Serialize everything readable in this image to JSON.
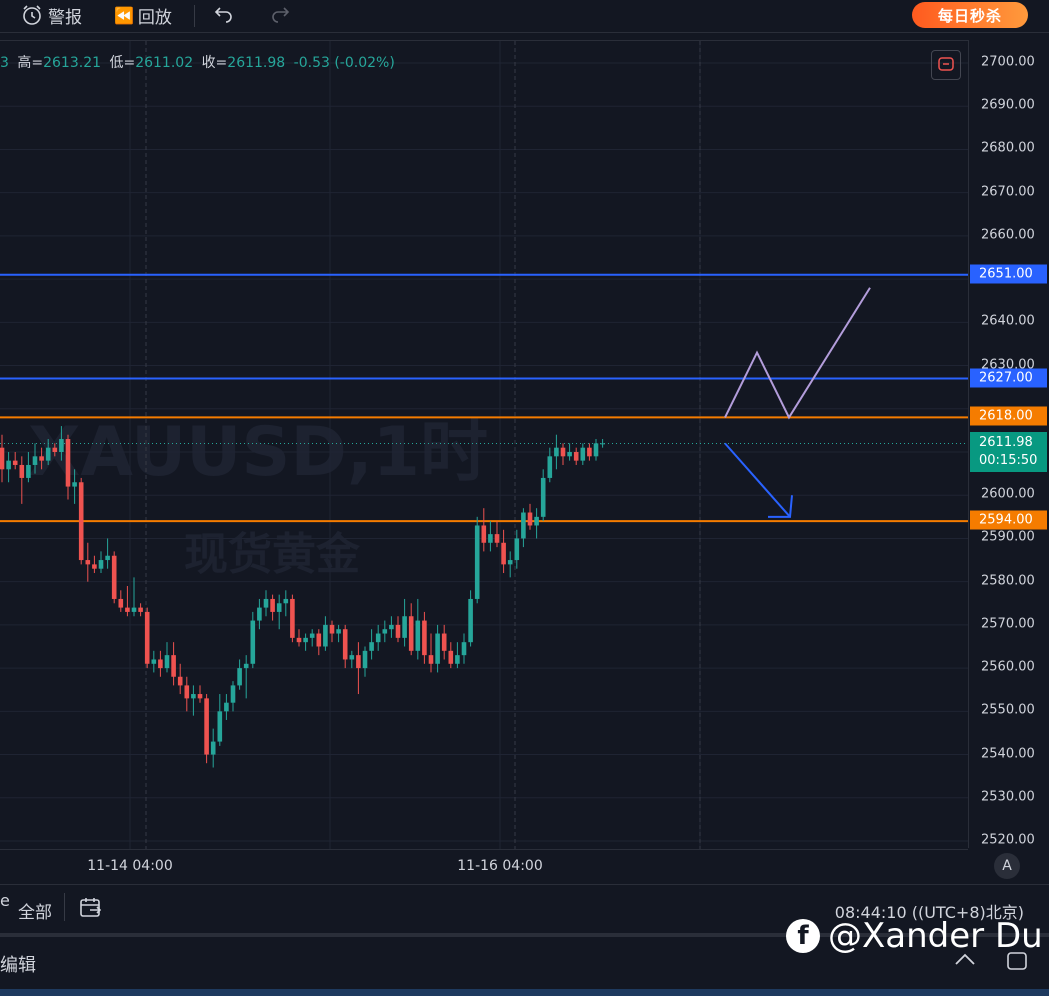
{
  "toolbar": {
    "alert_label": "警报",
    "replay_label": "回放",
    "promo_label": "每日秒杀"
  },
  "symbol": {
    "watermark_title": "XAUUSD,1时",
    "watermark_subtitle": "现货黄金"
  },
  "ohlc": {
    "open_tail": "3",
    "high_key": "高=",
    "high_val": "2613.21",
    "low_key": "低=",
    "low_val": "2611.02",
    "close_key": "收=",
    "close_val": "2611.98",
    "change": "-0.53 (-0.02%)"
  },
  "price_axis": {
    "ticks": [
      "2700.00",
      "2690.00",
      "2680.00",
      "2670.00",
      "2660.00",
      "2640.00",
      "2630.00",
      "2600.00",
      "2590.00",
      "2580.00",
      "2570.00",
      "2560.00",
      "2550.00",
      "2540.00",
      "2530.00",
      "2520.00"
    ],
    "levels": [
      {
        "value": "2651.00",
        "color": "#2962ff"
      },
      {
        "value": "2627.00",
        "color": "#2962ff"
      },
      {
        "value": "2618.00",
        "color": "#f57c00"
      },
      {
        "value": "2594.00",
        "color": "#f57c00"
      }
    ],
    "last_price": "2611.98",
    "countdown": "00:15:50"
  },
  "time_axis": {
    "labels": [
      "11-14 04:00",
      "11-16 04:00"
    ]
  },
  "bottom_bar": {
    "range_label": "全部",
    "clock": "08:44:10 ((UTC+8)北京)"
  },
  "edit_bar": {
    "edit_label": "编辑"
  },
  "credit": {
    "handle": "@Xander Du"
  },
  "auto_scale_label": "A",
  "colors": {
    "up": "#26a69a",
    "down": "#ef5350",
    "support_resistance_blue": "#2962ff",
    "support_resistance_orange": "#f57c00"
  },
  "chart_data": {
    "type": "candlestick",
    "symbol": "XAUUSD",
    "interval": "1时",
    "ylim": [
      2518,
      2705
    ],
    "candles": [
      [
        2611,
        2614,
        2603,
        2606
      ],
      [
        2606,
        2610,
        2603,
        2608
      ],
      [
        2608,
        2610,
        2606,
        2607
      ],
      [
        2607,
        2609,
        2598,
        2604
      ],
      [
        2604,
        2610,
        2603,
        2607
      ],
      [
        2607,
        2612,
        2605,
        2609
      ],
      [
        2609,
        2611,
        2606,
        2608
      ],
      [
        2608,
        2613,
        2607,
        2611
      ],
      [
        2611,
        2612,
        2609,
        2610
      ],
      [
        2610,
        2616,
        2608,
        2613
      ],
      [
        2613,
        2614,
        2599,
        2602
      ],
      [
        2602,
        2606,
        2598,
        2603
      ],
      [
        2603,
        2604,
        2584,
        2585
      ],
      [
        2585,
        2589,
        2580,
        2584
      ],
      [
        2584,
        2586,
        2582,
        2583
      ],
      [
        2583,
        2587,
        2582,
        2585
      ],
      [
        2585,
        2590,
        2583,
        2586
      ],
      [
        2586,
        2587,
        2575,
        2576
      ],
      [
        2576,
        2578,
        2573,
        2574
      ],
      [
        2574,
        2579,
        2572,
        2573
      ],
      [
        2573,
        2581,
        2572,
        2574
      ],
      [
        2574,
        2575,
        2572,
        2573
      ],
      [
        2573,
        2574,
        2560,
        2561
      ],
      [
        2561,
        2564,
        2559,
        2562
      ],
      [
        2562,
        2564,
        2558,
        2560
      ],
      [
        2560,
        2566,
        2559,
        2563
      ],
      [
        2563,
        2566,
        2556,
        2558
      ],
      [
        2558,
        2561,
        2554,
        2556
      ],
      [
        2556,
        2558,
        2550,
        2553
      ],
      [
        2553,
        2556,
        2549,
        2554
      ],
      [
        2554,
        2556,
        2552,
        2553
      ],
      [
        2553,
        2554,
        2538,
        2540
      ],
      [
        2540,
        2546,
        2537,
        2543
      ],
      [
        2543,
        2554,
        2542,
        2550
      ],
      [
        2550,
        2554,
        2548,
        2552
      ],
      [
        2552,
        2557,
        2550,
        2556
      ],
      [
        2556,
        2562,
        2555,
        2560
      ],
      [
        2560,
        2563,
        2553,
        2561
      ],
      [
        2561,
        2573,
        2560,
        2571
      ],
      [
        2571,
        2576,
        2569,
        2574
      ],
      [
        2574,
        2578,
        2572,
        2576
      ],
      [
        2576,
        2577,
        2571,
        2573
      ],
      [
        2573,
        2577,
        2569,
        2575
      ],
      [
        2575,
        2578,
        2572,
        2576
      ],
      [
        2576,
        2577,
        2566,
        2567
      ],
      [
        2567,
        2569,
        2565,
        2566
      ],
      [
        2566,
        2568,
        2564,
        2567
      ],
      [
        2567,
        2569,
        2565,
        2568
      ],
      [
        2568,
        2569,
        2563,
        2565
      ],
      [
        2565,
        2572,
        2564,
        2570
      ],
      [
        2570,
        2571,
        2566,
        2568
      ],
      [
        2568,
        2570,
        2566,
        2569
      ],
      [
        2569,
        2570,
        2560,
        2562
      ],
      [
        2562,
        2564,
        2560,
        2563
      ],
      [
        2563,
        2566,
        2554,
        2560
      ],
      [
        2560,
        2565,
        2558,
        2564
      ],
      [
        2564,
        2569,
        2562,
        2566
      ],
      [
        2566,
        2570,
        2564,
        2568
      ],
      [
        2568,
        2571,
        2566,
        2569
      ],
      [
        2569,
        2572,
        2567,
        2570
      ],
      [
        2570,
        2572,
        2566,
        2567
      ],
      [
        2567,
        2576,
        2565,
        2572
      ],
      [
        2572,
        2575,
        2563,
        2564
      ],
      [
        2564,
        2576,
        2562,
        2571
      ],
      [
        2571,
        2573,
        2561,
        2563
      ],
      [
        2563,
        2568,
        2559,
        2561
      ],
      [
        2561,
        2570,
        2559,
        2568
      ],
      [
        2568,
        2570,
        2562,
        2564
      ],
      [
        2564,
        2566,
        2560,
        2561
      ],
      [
        2561,
        2566,
        2560,
        2563
      ],
      [
        2563,
        2568,
        2561,
        2566
      ],
      [
        2566,
        2578,
        2565,
        2576
      ],
      [
        2576,
        2595,
        2575,
        2593
      ],
      [
        2593,
        2597,
        2587,
        2589
      ],
      [
        2589,
        2594,
        2587,
        2591
      ],
      [
        2591,
        2594,
        2588,
        2589
      ],
      [
        2589,
        2592,
        2582,
        2584
      ],
      [
        2584,
        2587,
        2581,
        2585
      ],
      [
        2585,
        2592,
        2583,
        2590
      ],
      [
        2590,
        2597,
        2588,
        2596
      ],
      [
        2596,
        2598,
        2592,
        2593
      ],
      [
        2593,
        2597,
        2590,
        2595
      ],
      [
        2595,
        2606,
        2594,
        2604
      ],
      [
        2604,
        2611,
        2603,
        2609
      ],
      [
        2609,
        2614,
        2606,
        2611
      ],
      [
        2611,
        2612,
        2607,
        2609
      ],
      [
        2609,
        2612,
        2608,
        2610
      ],
      [
        2610,
        2611,
        2607,
        2608
      ],
      [
        2608,
        2612,
        2607,
        2611
      ],
      [
        2611,
        2612,
        2608,
        2609
      ],
      [
        2609,
        2613,
        2608,
        2612
      ],
      [
        2612,
        2613,
        2611,
        2612
      ]
    ],
    "horizontal_levels": [
      2651,
      2627,
      2618,
      2594
    ],
    "projections": [
      {
        "name": "bullish path",
        "points": [
          [
            2618,
            2633,
            2618,
            2648
          ]
        ],
        "color": "#b39ddb"
      },
      {
        "name": "bearish path",
        "target": 2595,
        "color": "#2962ff"
      }
    ]
  }
}
